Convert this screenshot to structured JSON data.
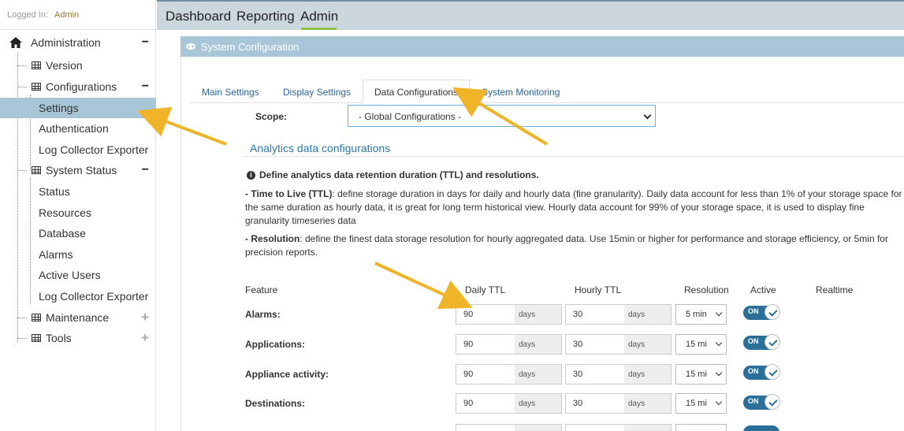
{
  "login": {
    "label": "Logged In:",
    "user": "Admin"
  },
  "sidebar": {
    "administration": "Administration",
    "version": "Version",
    "configurations": "Configurations",
    "settings": "Settings",
    "authentication": "Authentication",
    "log_collector_exporter_1": "Log Collector Exporter",
    "system_status": "System Status",
    "status": "Status",
    "resources": "Resources",
    "database": "Database",
    "alarms": "Alarms",
    "active_users": "Active Users",
    "log_collector_exporter_2": "Log Collector Exporter",
    "maintenance": "Maintenance",
    "tools": "Tools",
    "collapse_symbol": "−",
    "expand_symbol": "+"
  },
  "topnav": {
    "dashboard": "Dashboard",
    "reporting": "Reporting",
    "admin": "Admin",
    "active_color": "#8bc34a"
  },
  "panel": {
    "title": "System Configuration"
  },
  "tabs": {
    "main_settings": "Main Settings",
    "display_settings": "Display Settings",
    "data_configurations": "Data Configurations",
    "system_monitoring": "System Monitoring"
  },
  "scope": {
    "label": "Scope:",
    "value": "- Global Configurations -"
  },
  "section": {
    "title": "Analytics data configurations"
  },
  "info": {
    "heading": "Define analytics data retention duration (TTL) and resolutions.",
    "ttl_term": "- Time to Live (TTL)",
    "ttl_text": ": define storage duration in days for daily and hourly data (fine granularity). Daily data account for less than 1% of your storage space for the same duration as hourly data, it is great for long term historical view. Hourly data account for 99% of your storage space, it is used to display fine granularity timeseries data",
    "res_term": "- Resolution",
    "res_text": ": define the finest data storage resolution for hourly aggregated data. Use 15min or higher for performance and storage efficiency, or 5min for precision reports."
  },
  "table": {
    "headers": {
      "feature": "Feature",
      "daily_ttl": "Daily TTL",
      "hourly_ttl": "Hourly TTL",
      "resolution": "Resolution",
      "active": "Active",
      "realtime": "Realtime"
    },
    "unit": "days",
    "toggle_label": "ON",
    "rows": [
      {
        "feature": "Alarms:",
        "daily": "90",
        "hourly": "30",
        "resolution": "5 min"
      },
      {
        "feature": "Applications:",
        "daily": "90",
        "hourly": "30",
        "resolution": "15 mi"
      },
      {
        "feature": "Appliance activity:",
        "daily": "90",
        "hourly": "30",
        "resolution": "15 mi"
      },
      {
        "feature": "Destinations:",
        "daily": "90",
        "hourly": "30",
        "resolution": "15 mi"
      }
    ]
  },
  "colors": {
    "accent": "#2a6f97",
    "panel_header": "#a9c6d9",
    "annotation_arrow": "#f0b429"
  }
}
